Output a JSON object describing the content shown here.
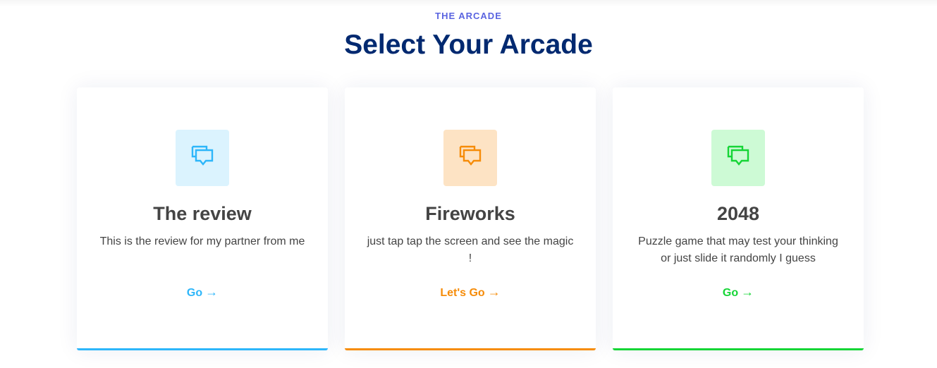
{
  "section": {
    "eyebrow": "THE ARCADE",
    "title": "Select Your Arcade"
  },
  "cards": [
    {
      "title": "The review",
      "description": "This is the review for my partner from me",
      "link_label": "Go",
      "icon": "chat-bubbles-icon",
      "accent_color": "#2db6fa",
      "icon_bg": "#dbf3fe"
    },
    {
      "title": "Fireworks",
      "description": "just tap tap the screen and see the magic !",
      "link_label": "Let's Go",
      "icon": "chat-bubbles-icon",
      "accent_color": "#f68c09",
      "icon_bg": "#fde3c4"
    },
    {
      "title": "2048",
      "description": "Puzzle game that may test your thinking or just slide it randomly I guess",
      "link_label": "Go",
      "icon": "chat-bubbles-icon",
      "accent_color": "#15d536",
      "icon_bg": "#cdfad5"
    }
  ],
  "arrow_glyph": "→"
}
